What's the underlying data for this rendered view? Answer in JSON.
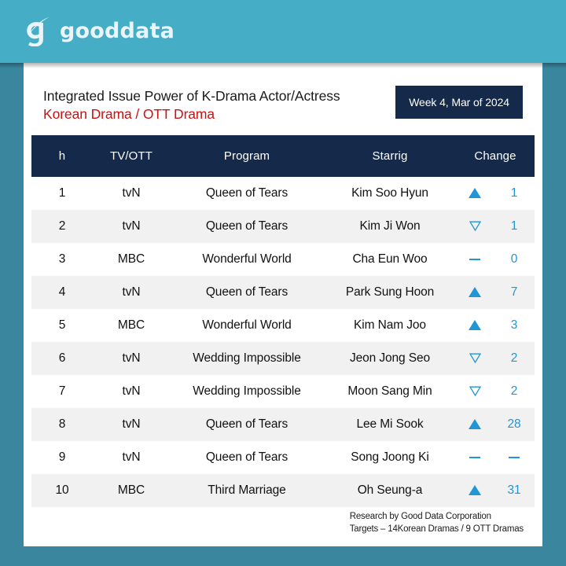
{
  "brand": {
    "name": "gooddata",
    "logo_icon": "gooddata-g-swoosh-icon",
    "banner_color": "#46adc6",
    "frame_color": "#3a869e"
  },
  "header": {
    "title": "Integrated Issue Power of K-Drama Actor/Actress",
    "subtitle": "Korean Drama /  OTT  Drama",
    "subtitle_color": "#cc1111",
    "date_badge": "Week 4,  Mar of 2024",
    "badge_color": "#15294a"
  },
  "table": {
    "columns": [
      "h",
      "TV/OTT",
      "Program",
      "Starrig",
      "Change"
    ],
    "header_bg": "#15294a",
    "accent_color": "#2196d4",
    "rows": [
      {
        "rank": "1",
        "tv": "tvN",
        "program": "Queen of Tears",
        "star": "Kim Soo Hyun",
        "dir": "up",
        "delta": "1"
      },
      {
        "rank": "2",
        "tv": "tvN",
        "program": "Queen of Tears",
        "star": "Kim Ji Won",
        "dir": "down",
        "delta": "1"
      },
      {
        "rank": "3",
        "tv": "MBC",
        "program": "Wonderful World",
        "star": "Cha Eun Woo",
        "dir": "flat",
        "delta": "0"
      },
      {
        "rank": "4",
        "tv": "tvN",
        "program": "Queen of Tears",
        "star": "Park Sung Hoon",
        "dir": "up",
        "delta": "7"
      },
      {
        "rank": "5",
        "tv": "MBC",
        "program": "Wonderful World",
        "star": "Kim Nam Joo",
        "dir": "up",
        "delta": "3"
      },
      {
        "rank": "6",
        "tv": "tvN",
        "program": "Wedding Impossible",
        "star": "Jeon Jong Seo",
        "dir": "down",
        "delta": "2"
      },
      {
        "rank": "7",
        "tv": "tvN",
        "program": "Wedding Impossible",
        "star": "Moon Sang Min",
        "dir": "down",
        "delta": "2"
      },
      {
        "rank": "8",
        "tv": "tvN",
        "program": "Queen of Tears",
        "star": "Lee Mi Sook",
        "dir": "up",
        "delta": "28"
      },
      {
        "rank": "9",
        "tv": "tvN",
        "program": "Queen of Tears",
        "star": "Song Joong Ki",
        "dir": "flat",
        "delta": "-"
      },
      {
        "rank": "10",
        "tv": "MBC",
        "program": "Third Marriage",
        "star": "Oh Seung-a",
        "dir": "up",
        "delta": "31"
      }
    ]
  },
  "footer": {
    "line1": "Research by Good Data Corporation",
    "line2": "Targets – 14Korean Dramas / 9 OTT Dramas"
  }
}
